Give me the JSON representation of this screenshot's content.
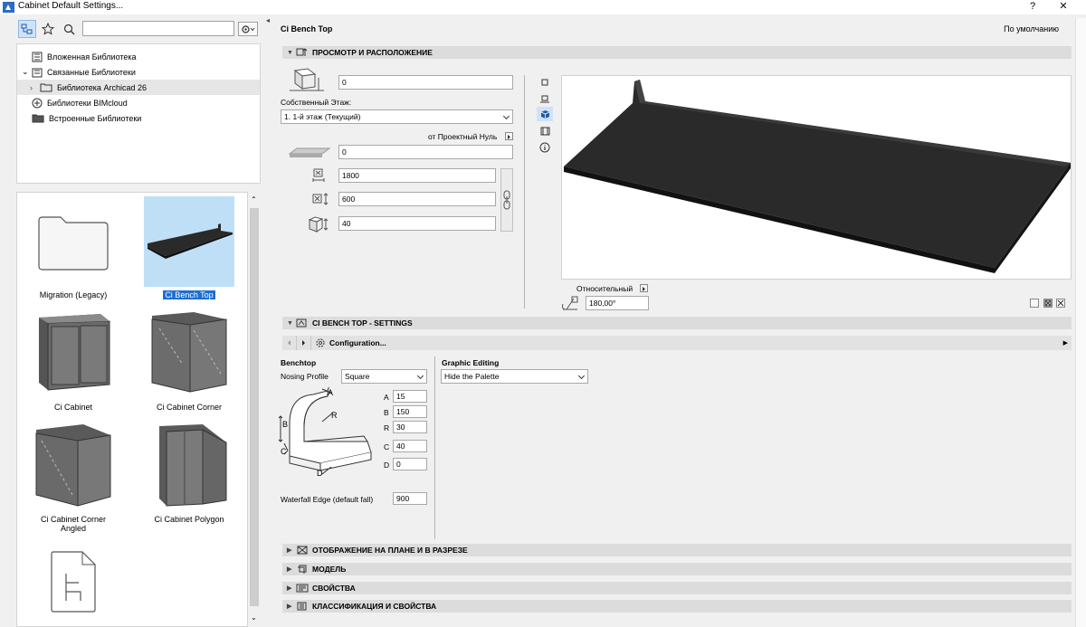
{
  "window": {
    "title": "Cabinet Default Settings...",
    "help_label": "?",
    "close_label": "✕"
  },
  "library": {
    "search_placeholder": "",
    "tree": [
      {
        "label": "Вложенная Библиотека",
        "expander": ""
      },
      {
        "label": "Связанные Библиотеки",
        "expander": "⌄"
      },
      {
        "label": "Библиотека Archicad 26",
        "expander": "›"
      },
      {
        "label": "Библиотеки BIMcloud",
        "expander": ""
      },
      {
        "label": "Встроенные Библиотеки",
        "expander": ""
      }
    ],
    "objects": [
      {
        "label": "Migration (Legacy)"
      },
      {
        "label": "Ci Bench Top"
      },
      {
        "label": "Ci Cabinet"
      },
      {
        "label": "Ci Cabinet Corner"
      },
      {
        "label": "Ci Cabinet Corner Angled"
      },
      {
        "label": "Ci Cabinet Polygon"
      }
    ]
  },
  "panel": {
    "object_name": "Ci Bench Top",
    "default_label": "По умолчанию",
    "section_view": "ПРОСМОТР И РАСПОЛОЖЕНИЕ",
    "elevation_value": "0",
    "home_story_label": "Собственный Этаж:",
    "home_story_value": "1. 1-й этаж (Текущий)",
    "reference_label": "от Проектный Нуль",
    "offset_value": "0",
    "length_value": "1800",
    "width_value": "600",
    "height_value": "40",
    "relative_label": "Относительный",
    "angle_value": "180,00°",
    "section_settings": "CI BENCH TOP - SETTINGS",
    "configuration_label": "Configuration...",
    "benchtop_heading": "Benchtop",
    "nosing_label": "Nosing Profile",
    "nosing_value": "Square",
    "graphic_heading": "Graphic Editing",
    "graphic_value": "Hide the Palette",
    "params": [
      {
        "name": "A",
        "value": "15"
      },
      {
        "name": "B",
        "value": "150"
      },
      {
        "name": "R",
        "value": "30"
      },
      {
        "name": "C",
        "value": "40"
      },
      {
        "name": "D",
        "value": "0"
      }
    ],
    "diagram_labels": {
      "a": "A",
      "b": "B",
      "r": "R",
      "c": "C",
      "d": "D"
    },
    "waterfall_label": "Waterfall Edge (default fall)",
    "waterfall_value": "900",
    "section_plan": "ОТОБРАЖЕНИЕ НА ПЛАНЕ И В РАЗРЕЗЕ",
    "section_model": "МОДЕЛЬ",
    "section_props": "СВОЙСТВА",
    "section_class": "КЛАССИФИКАЦИЯ И СВОЙСТВА"
  },
  "colors": {
    "accent": "#1e6fd0",
    "selection": "#bfdff7",
    "model": "#2a2a2a"
  },
  "icons": [
    "search-icon",
    "star-icon",
    "gear-icon",
    "folder-icon",
    "library-icon",
    "link-icon",
    "cloud-icon",
    "chain-link-icon",
    "info-icon"
  ]
}
